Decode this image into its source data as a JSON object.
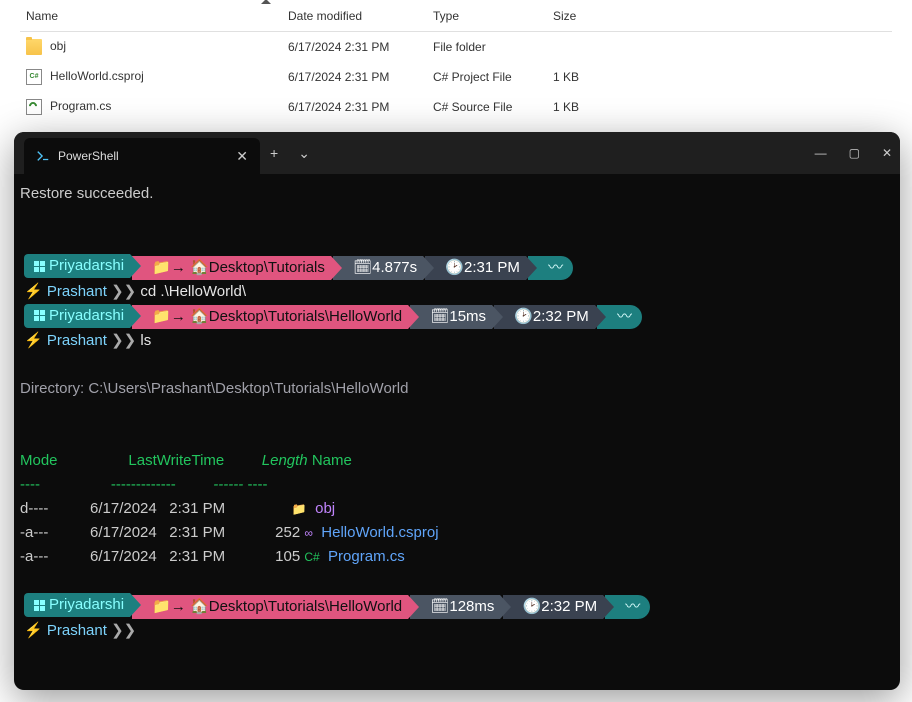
{
  "explorer": {
    "columns": [
      "Name",
      "Date modified",
      "Type",
      "Size"
    ],
    "rows": [
      {
        "icon": "folder",
        "name": "obj",
        "date": "6/17/2024 2:31 PM",
        "type": "File folder",
        "size": ""
      },
      {
        "icon": "csproj",
        "name": "HelloWorld.csproj",
        "date": "6/17/2024 2:31 PM",
        "type": "C# Project File",
        "size": "1 KB"
      },
      {
        "icon": "cs",
        "name": "Program.cs",
        "date": "6/17/2024 2:31 PM",
        "type": "C# Source File",
        "size": "1 KB"
      }
    ]
  },
  "terminal": {
    "tab_title": "PowerShell",
    "lines": {
      "restore": "Restore succeeded.",
      "host": "Priyadarshi",
      "path1": "Desktop\\Tutorials",
      "dur1": "4.877s",
      "time1": "2:31 PM",
      "user": "Prashant",
      "cmd1": "cd .\\HelloWorld\\",
      "path2": "Desktop\\Tutorials\\HelloWorld",
      "dur2": "15ms",
      "time2": "2:32 PM",
      "cmd2": "ls",
      "dirline": "    Directory: C:\\Users\\Prashant\\Desktop\\Tutorials\\HelloWorld",
      "hdr_mode": "Mode",
      "hdr_lwt": "LastWriteTime",
      "hdr_len": "Length",
      "hdr_name": "Name",
      "u_mode": "----",
      "u_lwt": "-------------",
      "u_len": "------",
      "u_name": "----",
      "r1": {
        "mode": "d----",
        "date": "6/17/2024",
        "time": "2:31 PM",
        "len": "",
        "icon": "📁",
        "name": "obj"
      },
      "r2": {
        "mode": "-a---",
        "date": "6/17/2024",
        "time": "2:31 PM",
        "len": "252",
        "icon": "vs",
        "name": "HelloWorld.csproj"
      },
      "r3": {
        "mode": "-a---",
        "date": "6/17/2024",
        "time": "2:31 PM",
        "len": "105",
        "icon": "C#",
        "name": "Program.cs"
      },
      "dur3": "128ms",
      "time3": "2:32 PM"
    }
  }
}
